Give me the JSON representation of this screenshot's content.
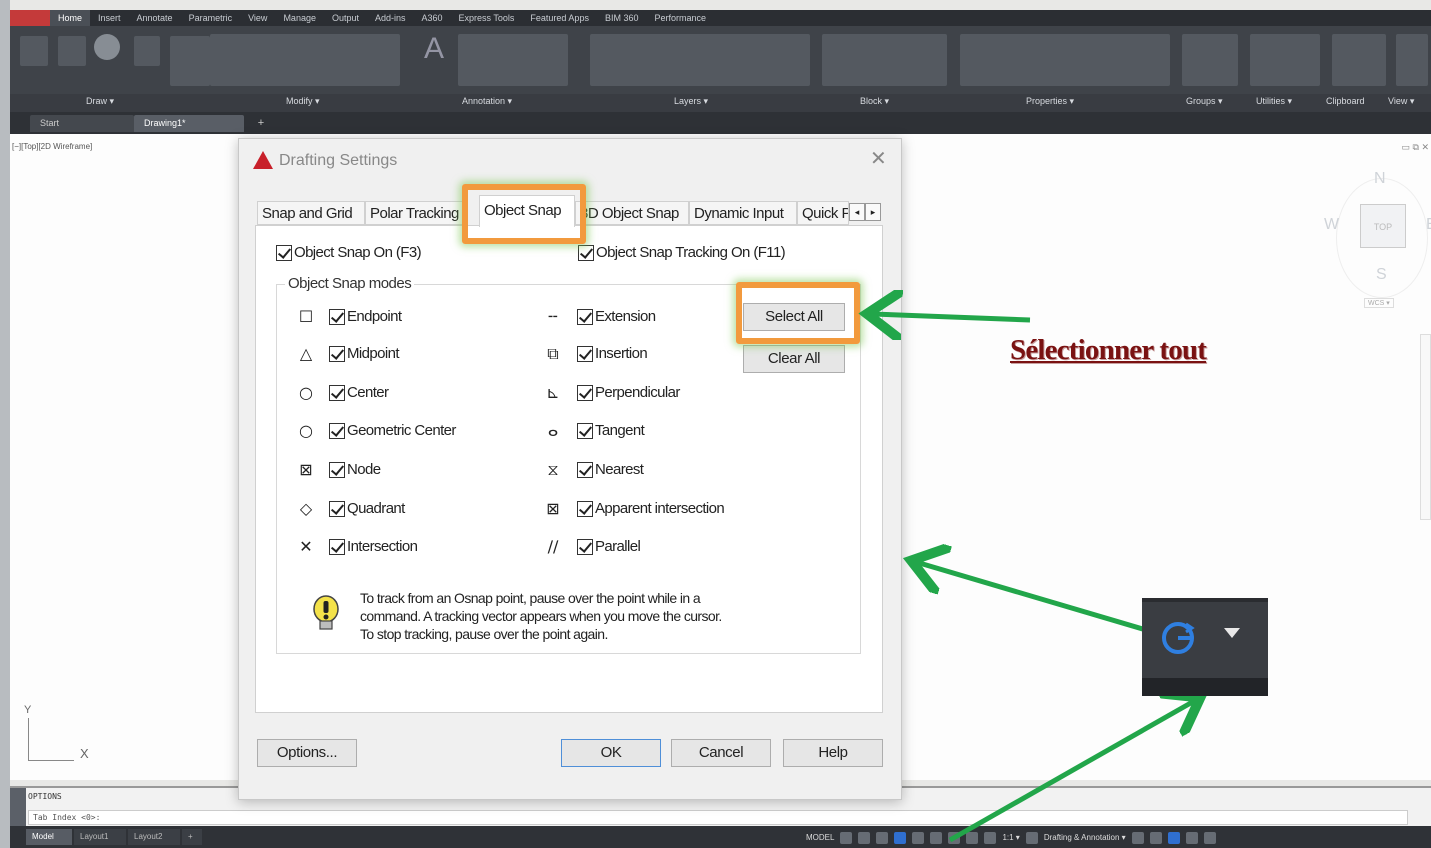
{
  "ribbon": {
    "tabs": [
      "Home",
      "Insert",
      "Annotate",
      "Parametric",
      "View",
      "Manage",
      "Output",
      "Add-ins",
      "A360",
      "Express Tools",
      "Featured Apps",
      "BIM 360",
      "Performance"
    ],
    "panels": [
      "Draw ▾",
      "Modify ▾",
      "Annotation ▾",
      "Layers ▾",
      "Block ▾",
      "Properties ▾",
      "Groups ▾",
      "Utilities ▾",
      "Clipboard",
      "View ▾"
    ]
  },
  "doc_tabs": {
    "start": "Start",
    "drawing": "Drawing1*",
    "plus": "+"
  },
  "viewport": {
    "label": "[−][Top][2D Wireframe]",
    "controls": "▭ ⧉ ✕"
  },
  "viewcube": {
    "n": "N",
    "s": "S",
    "e": "E",
    "w": "W",
    "face": "TOP",
    "wcs": "WCS ▾"
  },
  "ucs": {
    "x": "X",
    "y": "Y"
  },
  "command_line": {
    "history": "OPTIONS",
    "input": "Tab Index <0>:"
  },
  "status_tabs": [
    "Model",
    "Layout1",
    "Layout2",
    "+"
  ],
  "status_right": {
    "model": "MODEL",
    "scale": "1:1 ▾",
    "workspace": "Drafting & Annotation ▾"
  },
  "dialog": {
    "title": "Drafting Settings",
    "close": "✕",
    "tabs": [
      {
        "label": "Snap and Grid"
      },
      {
        "label": "Polar Tracking"
      },
      {
        "label": "Object Snap"
      },
      {
        "label": "3D Object Snap"
      },
      {
        "label": "Dynamic Input"
      },
      {
        "label": "Quick Properties"
      }
    ],
    "tab_scroll_left": "◂",
    "tab_scroll_right": "▸",
    "snap_on": "Object Snap On (F3)",
    "tracking_on": "Object Snap Tracking On (F11)",
    "modes_group": "Object Snap modes",
    "left_modes": [
      "Endpoint",
      "Midpoint",
      "Center",
      "Geometric Center",
      "Node",
      "Quadrant",
      "Intersection"
    ],
    "right_modes": [
      "Extension",
      "Insertion",
      "Perpendicular",
      "Tangent",
      "Nearest",
      "Apparent intersection",
      "Parallel"
    ],
    "left_symbols": [
      "☐",
      "△",
      "○",
      "○",
      "⊠",
      "◇",
      "✕"
    ],
    "right_symbols": [
      "╌",
      "⧉",
      "⊾",
      "ⴰ",
      "⧖",
      "⊠",
      "∕∕"
    ],
    "select_all": "Select All",
    "clear_all": "Clear All",
    "tip": [
      "To track from an Osnap point, pause over the point while in a",
      "command.  A tracking vector appears when you move the cursor.",
      "To stop tracking, pause over the point again."
    ],
    "options_button": "Options...",
    "ok_button": "OK",
    "cancel_button": "Cancel",
    "help_button": "Help"
  },
  "annotation": {
    "caption": "Sélectionner tout"
  },
  "colors": {
    "highlight": "#f29a3d",
    "arrow": "#22a64a",
    "caption": "#7a1212"
  }
}
